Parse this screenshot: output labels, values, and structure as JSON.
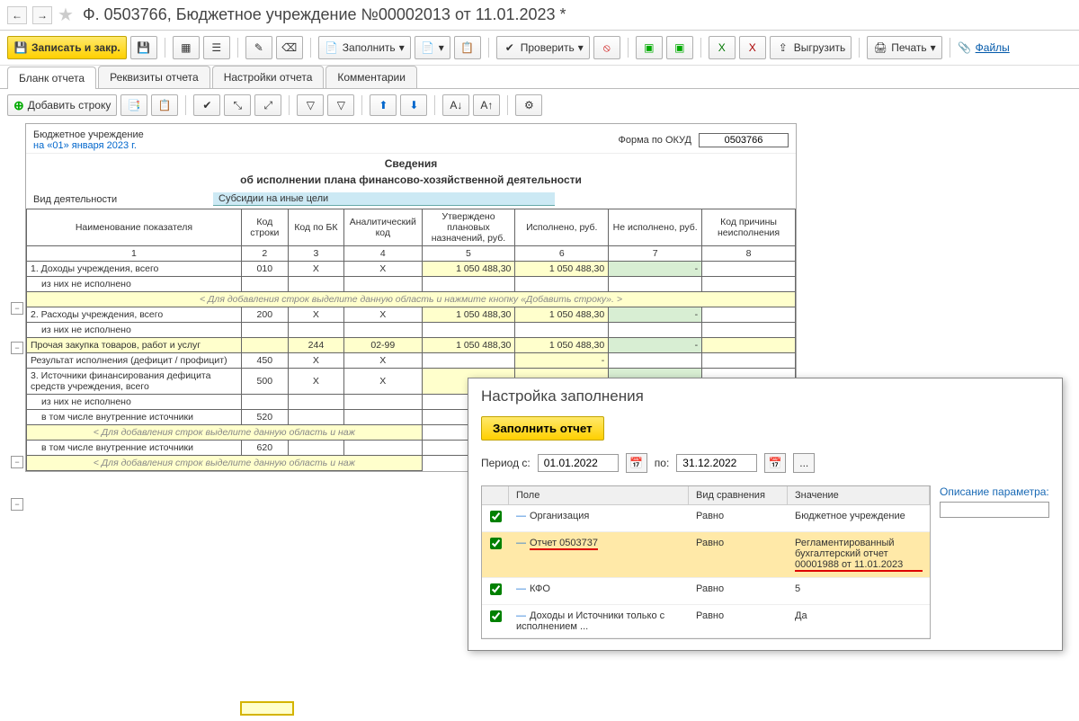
{
  "title": "Ф. 0503766, Бюджетное учреждение №00002013 от 11.01.2023 *",
  "toolbar": {
    "save_close": "Записать и закр.",
    "fill": "Заполнить",
    "check": "Проверить",
    "export": "Выгрузить",
    "print": "Печать",
    "files": "Файлы"
  },
  "tabs": [
    "Бланк отчета",
    "Реквизиты отчета",
    "Настройки отчета",
    "Комментарии"
  ],
  "subtoolbar": {
    "add_row": "Добавить строку"
  },
  "report": {
    "org_name": "Бюджетное учреждение",
    "org_date": "на «01» января 2023 г.",
    "form_label": "Форма по ОКУД",
    "form_code": "0503766",
    "title": "Сведения",
    "subtitle": "об исполнении плана финансово-хозяйственной деятельности",
    "activity_label": "Вид деятельности",
    "activity_value": "Субсидии на иные цели",
    "headers": [
      "Наименование показателя",
      "Код строки",
      "Код по БК",
      "Аналитический код",
      "Утверждено плановых назначений, руб.",
      "Исполнено, руб.",
      "Не исполнено, руб.",
      "Код причины неисполнения"
    ],
    "nums": [
      "1",
      "2",
      "3",
      "4",
      "5",
      "6",
      "7",
      "8"
    ],
    "rows": [
      {
        "name": "1. Доходы учреждения, всего",
        "code": "010",
        "bk": "X",
        "an": "X",
        "plan": "1 050 488,30",
        "done": "1 050 488,30",
        "not": "-",
        "reason": ""
      },
      {
        "name": "из них не исполнено",
        "indent": 1
      },
      {
        "hint": "< Для добавления строк выделите данную область и нажмите кнопку «Добавить строку». >"
      },
      {
        "name": "2. Расходы учреждения, всего",
        "code": "200",
        "bk": "X",
        "an": "X",
        "plan": "1 050 488,30",
        "done": "1 050 488,30",
        "not": "-",
        "reason": ""
      },
      {
        "name": "из них не исполнено",
        "indent": 1
      },
      {
        "name": "Прочая закупка товаров, работ и услуг",
        "bk": "244",
        "an": "02-99",
        "plan": "1 050 488,30",
        "done": "1 050 488,30",
        "not": "-",
        "reason": "",
        "hl": true
      },
      {
        "name": "Результат исполнения (дефицит / профицит)",
        "code": "450",
        "bk": "X",
        "an": "X",
        "plan": "",
        "done": "-",
        "not": "",
        "reason": ""
      },
      {
        "name": "3. Источники финансирования дефицита средств учреждения, всего",
        "code": "500",
        "bk": "X",
        "an": "X",
        "plan": "-",
        "done": "-",
        "not": "-",
        "reason": ""
      },
      {
        "name": "из них не исполнено",
        "indent": 1
      },
      {
        "name": "в том числе внутренние источники",
        "code": "520",
        "indent": 1,
        "wide": true
      },
      {
        "hint": "< Для добавления строк выделите данную область и наж",
        "truncated": true
      },
      {
        "name": "в том числе внутренние источники",
        "code": "620",
        "indent": 1,
        "wide": true
      },
      {
        "hint": "< Для добавления строк выделите данную область и наж",
        "truncated": true
      }
    ]
  },
  "dialog": {
    "title": "Настройка заполнения",
    "fill_btn": "Заполнить отчет",
    "period_from_label": "Период с:",
    "period_from": "01.01.2022",
    "period_to_label": "по:",
    "period_to": "31.12.2022",
    "columns": [
      "Поле",
      "Вид сравнения",
      "Значение"
    ],
    "desc_label": "Описание параметра:",
    "rows": [
      {
        "chk": true,
        "field": "Организация",
        "cmp": "Равно",
        "val": "Бюджетное учреждение"
      },
      {
        "chk": true,
        "field": "Отчет 0503737",
        "cmp": "Равно",
        "val": "Регламентированный бухгалтерский отчет 00001988 от 11.01.2023",
        "hl": true,
        "underline": true
      },
      {
        "chk": true,
        "field": "КФО",
        "cmp": "Равно",
        "val": "5"
      },
      {
        "chk": true,
        "field": "Доходы и Источники только с исполнением ...",
        "cmp": "Равно",
        "val": "Да"
      }
    ]
  }
}
